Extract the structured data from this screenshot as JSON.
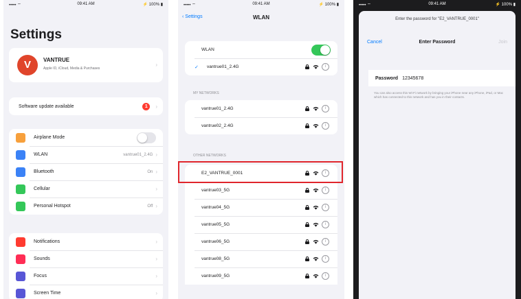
{
  "status_bar": {
    "carrier": "••••• ⌔",
    "time": "09:41 AM",
    "battery": "⚡ 100% ▮"
  },
  "settings": {
    "title": "Settings",
    "account": {
      "avatar_letter": "V",
      "name": "VANTRUE",
      "subtitle": "Apple ID, iCloud, Media & Purchases"
    },
    "update": {
      "label": "Software update available",
      "badge": "1"
    },
    "group1": [
      {
        "label": "Airplane Mode",
        "icon": "airplane-icon",
        "color": "#f7a03c",
        "kind": "toggle-off"
      },
      {
        "label": "WLAN",
        "icon": "wifi-icon",
        "color": "#3b82f6",
        "value": "vantrue01_2.4G",
        "kind": "chevron"
      },
      {
        "label": "Bluetooth",
        "icon": "bluetooth-icon",
        "color": "#3b82f6",
        "value": "On",
        "kind": "chevron"
      },
      {
        "label": "Cellular",
        "icon": "cellular-icon",
        "color": "#34c759",
        "value": "",
        "kind": "chevron"
      },
      {
        "label": "Personal Hotspot",
        "icon": "hotspot-icon",
        "color": "#34c759",
        "value": "Off",
        "kind": "chevron"
      }
    ],
    "group2": [
      {
        "label": "Notifications",
        "icon": "notifications-icon",
        "color": "#ff3b30"
      },
      {
        "label": "Sounds",
        "icon": "sounds-icon",
        "color": "#ff2d55"
      },
      {
        "label": "Focus",
        "icon": "focus-icon",
        "color": "#5856d6"
      },
      {
        "label": "Screen Time",
        "icon": "screen-time-icon",
        "color": "#5856d6"
      }
    ]
  },
  "wlan": {
    "back_label": "Settings",
    "title": "WLAN",
    "toggle_label": "WLAN",
    "toggle_color": "#34c759",
    "connected": "vantrue01_2.4G",
    "my_networks_header": "MY NETWORKS",
    "my_networks": [
      "vantrue01_2.4G",
      "vantrue02_2.4G"
    ],
    "other_networks_header": "OTHER NETWORKS",
    "other_networks": [
      "E2_VANTRUE_0001",
      "vantrue03_5G",
      "vantrue04_5G",
      "vantrue05_5G",
      "vantrue06_5G",
      "vantrue08_5G",
      "vantrue09_5G"
    ],
    "highlight_color": "#e0252b"
  },
  "password": {
    "sheet_top": "Enter the password for \"E2_VANTRUE_0001\"",
    "cancel": "Cancel",
    "title": "Enter Password",
    "join": "Join",
    "field_label": "Password",
    "field_value": "12345678",
    "note": "You can also access this Wi-Fi network by bringing your iPhone near any iPhone, iPad, or Mac which has connected to this network and has you in their contacts."
  }
}
